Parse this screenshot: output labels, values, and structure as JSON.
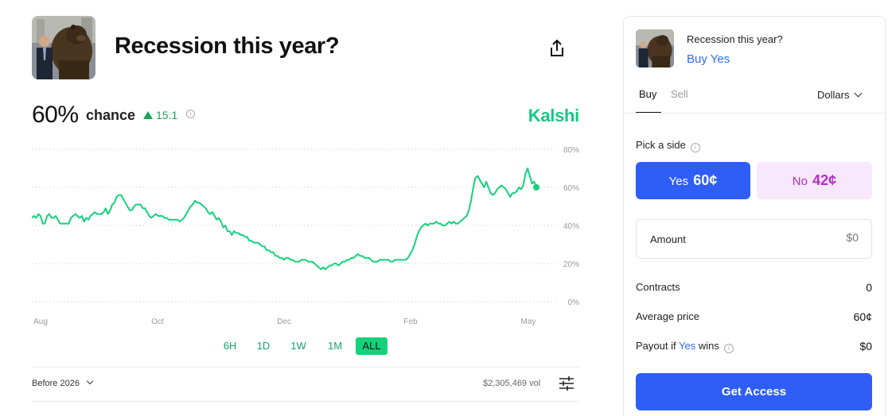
{
  "market": {
    "title": "Recession this year?",
    "probability": "60%",
    "chance_label": "chance",
    "delta": "15.1",
    "brand": "Kalshi"
  },
  "chart_data": {
    "type": "line",
    "yticks": [
      "80%",
      "60%",
      "40%",
      "20%",
      "0%"
    ],
    "xticks": [
      "Aug",
      "Oct",
      "Dec",
      "Feb",
      "May"
    ],
    "ylim": [
      0,
      80
    ],
    "grid": true,
    "line_color": "#16d17c",
    "series": [
      {
        "values": [
          44,
          45,
          44,
          46,
          45,
          41,
          41,
          45,
          46,
          44,
          44,
          45,
          43,
          41,
          41,
          41,
          41,
          41,
          44,
          45,
          46,
          45,
          44,
          45,
          42,
          44,
          43,
          45,
          46,
          47,
          46,
          46,
          46,
          47,
          49,
          46,
          48,
          51,
          52,
          55,
          56,
          56,
          54,
          52,
          50,
          48,
          48,
          50,
          51,
          51,
          51,
          49,
          49,
          47,
          45,
          44,
          45,
          46,
          45,
          45,
          45,
          44,
          44,
          43,
          43,
          43,
          43,
          43,
          42,
          43,
          44,
          46,
          48,
          50,
          51,
          53,
          52,
          52,
          51,
          50,
          49,
          47,
          46,
          47,
          45,
          43,
          44,
          42,
          39,
          40,
          37,
          37,
          35,
          37,
          36,
          36,
          35,
          35,
          34,
          34,
          32,
          32,
          31,
          31,
          31,
          30,
          29,
          29,
          27,
          27,
          26,
          26,
          24,
          24,
          23,
          23,
          22,
          23,
          23,
          22,
          22,
          21,
          21,
          21,
          22,
          22,
          22,
          21,
          21,
          21,
          20,
          19,
          18,
          17,
          18,
          17,
          18,
          19,
          19,
          20,
          20,
          19,
          20,
          21,
          21,
          22,
          22,
          23,
          23,
          24,
          25,
          24,
          24,
          23,
          23,
          23,
          22,
          21,
          21,
          21,
          22,
          22,
          22,
          22,
          22,
          21,
          21,
          22,
          22,
          22,
          22,
          22,
          22,
          23,
          25,
          27,
          30,
          34,
          37,
          39,
          40,
          41,
          40,
          41,
          41,
          41,
          42,
          41,
          41,
          40,
          40,
          41,
          42,
          41,
          42,
          41,
          41,
          42,
          43,
          44,
          45,
          48,
          53,
          60,
          65,
          66,
          64,
          62,
          60,
          63,
          60,
          57,
          56,
          57,
          59,
          60,
          61,
          60,
          59,
          57,
          55,
          57,
          57,
          58,
          60,
          59,
          61,
          67,
          70,
          66,
          62,
          63,
          60
        ]
      }
    ]
  },
  "ranges": [
    "6H",
    "1D",
    "1W",
    "1M",
    "ALL"
  ],
  "active_range": "ALL",
  "footer": {
    "filter_label": "Before 2026",
    "volume": "$2,305,469 vol"
  },
  "trade": {
    "question": "Recession this year?",
    "action": "Buy Yes",
    "tabs": [
      "Buy",
      "Sell"
    ],
    "currency": "Dollars",
    "pick_label": "Pick a side",
    "yes_label": "Yes",
    "yes_price": "60¢",
    "no_label": "No",
    "no_price": "42¢",
    "amount_label": "Amount",
    "amount_placeholder": "$0",
    "contracts_label": "Contracts",
    "contracts_value": "0",
    "avg_label": "Average price",
    "avg_value": "60¢",
    "payout_prefix": "Payout if",
    "payout_yes": "Yes",
    "payout_suffix": "wins",
    "payout_value": "$0",
    "cta": "Get Access"
  },
  "colors": {
    "accent_blue": "#2f5ef6",
    "brand_green": "#16c784",
    "no_purple": "#b52acb"
  },
  "icons": {
    "share": "share-icon",
    "info": "info-icon",
    "settings": "sliders-icon",
    "chevron": "chevron-down-icon"
  }
}
